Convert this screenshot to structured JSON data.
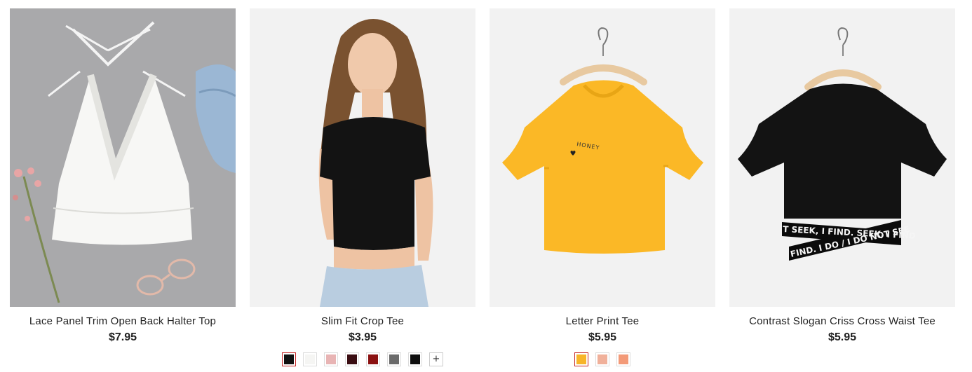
{
  "products": [
    {
      "name": "Lace Panel Trim Open Back Halter Top",
      "price": "$7.95",
      "image_desc": "white lace halter top on grey background"
    },
    {
      "name": "Slim Fit Crop Tee",
      "price": "$3.95",
      "swatches": [
        "#111111",
        "#f5f5f3",
        "#e8b4b4",
        "#3a0d12",
        "#8b1111",
        "#6a6a6a",
        "#0e0e0e"
      ],
      "more_label": "+"
    },
    {
      "name": "Letter Print Tee",
      "price": "$5.95",
      "print_text": "HONEY",
      "swatches": [
        "#f7b52a",
        "#f0b09a",
        "#f39a78"
      ]
    },
    {
      "name": "Contrast Slogan Criss Cross Waist Tee",
      "price": "$5.95",
      "band_text_top": "T SEEK, I FIND. SEEK, I FIND",
      "band_text_bottom": "FIND. I DO / I DO NOT SEE"
    }
  ],
  "colors": {
    "price": "#222222",
    "selected_swatch_border": "#c62828"
  }
}
